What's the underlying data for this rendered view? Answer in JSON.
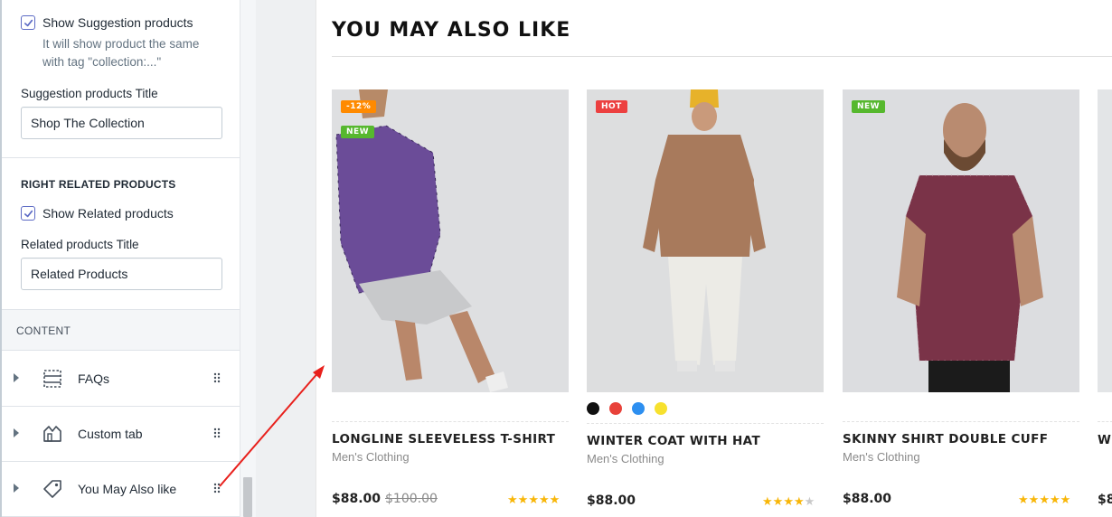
{
  "editor": {
    "suggestion_checkbox_label": "Show Suggestion products",
    "suggestion_checked": true,
    "suggestion_help_line1": "It will show product the same",
    "suggestion_help_line2": "with tag \"collection:...\"",
    "suggestion_title_label": "Suggestion products Title",
    "suggestion_title_value": "Shop The Collection",
    "related_heading": "RIGHT RELATED PRODUCTS",
    "related_checkbox_label": "Show Related products",
    "related_checked": true,
    "related_title_label": "Related products Title",
    "related_title_value": "Related Products",
    "content_heading": "CONTENT",
    "blocks": [
      {
        "label": "FAQs",
        "icon": "faq-block-icon"
      },
      {
        "label": "Custom tab",
        "icon": "custom-tab-icon"
      },
      {
        "label": "You May Also like",
        "icon": "tag-icon"
      }
    ]
  },
  "store": {
    "section_title": "YOU MAY ALSO LIKE",
    "products": [
      {
        "name": "LONGLINE SLEEVELESS T-SHIRT",
        "category": "Men's Clothing",
        "price": "$88.00",
        "old_price": "$100.00",
        "rating": 5,
        "badges": [
          {
            "text": "-12%",
            "color": "#ff8a00"
          },
          {
            "text": "NEW",
            "color": "#56b82e"
          }
        ]
      },
      {
        "name": "WINTER COAT WITH HAT",
        "category": "Men's Clothing",
        "price": "$88.00",
        "rating": 4,
        "badges": [
          {
            "text": "HOT",
            "color": "#ec4040"
          }
        ],
        "swatches": [
          "#111111",
          "#e8423a",
          "#2d8ff0",
          "#f7e12e"
        ]
      },
      {
        "name": "SKINNY SHIRT DOUBLE CUFF",
        "category": "Men's Clothing",
        "price": "$88.00",
        "rating": 5,
        "badges": [
          {
            "text": "NEW",
            "color": "#56b82e"
          }
        ]
      }
    ],
    "peek_name": "WI",
    "peek_price": "$8"
  },
  "colors": {
    "accent": "#5c6ac4",
    "annotation_arrow": "#e8201c",
    "star": "#f8b608"
  }
}
